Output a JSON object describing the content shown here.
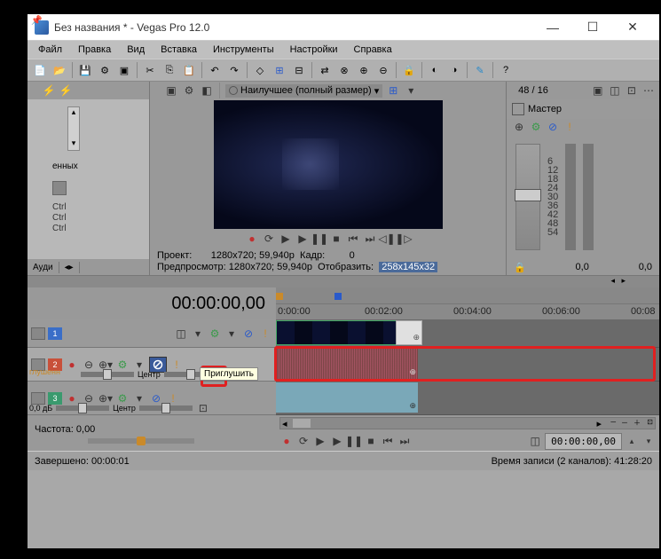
{
  "window": {
    "title": "Без названия * - Vegas Pro 12.0"
  },
  "menu": {
    "file": "Файл",
    "edit": "Правка",
    "view": "Вид",
    "insert": "Вставка",
    "tools": "Инструменты",
    "options": "Настройки",
    "help": "Справка"
  },
  "explorer": {
    "label_scripted": "енных",
    "ctrl1": "Ctrl",
    "ctrl2": "Ctrl",
    "ctrl3": "Ctrl",
    "tab_audio": "Ауди"
  },
  "preview": {
    "quality": "Наилучшее (полный размер)",
    "info_project": "Проект:",
    "info_project_val": "1280x720; 59,940p",
    "info_preview": "Предпросмотр:",
    "info_preview_val": "1280x720; 59,940p",
    "info_frame": "Кадр:",
    "info_frame_val": "0",
    "info_display": "Отобразить:",
    "info_display_val": "258x145x32"
  },
  "mixer": {
    "rate": "48 / 16",
    "master": "Мастер",
    "scale": [
      "6",
      "12",
      "18",
      "24",
      "30",
      "36",
      "42",
      "48",
      "54"
    ],
    "left_val": "0,0",
    "right_val": "0,0"
  },
  "timeline": {
    "position": "00:00:00,00",
    "ruler": [
      "0:00:00",
      "00:02:00",
      "00:04:00",
      "00:06:00",
      "00:08"
    ],
    "track2_mute_tooltip": "Приглушить",
    "track2_label_cut": "глушенн",
    "track2_pan": "Центр",
    "track3_vol": "0,0 дБ",
    "track3_pan": "Центр",
    "freq_label": "Частота:",
    "freq_val": "0,00",
    "timecode": "00:00:00,00"
  },
  "status": {
    "completed": "Завершено: 00:00:01",
    "record": "Время записи (2 каналов): 41:28:20"
  }
}
